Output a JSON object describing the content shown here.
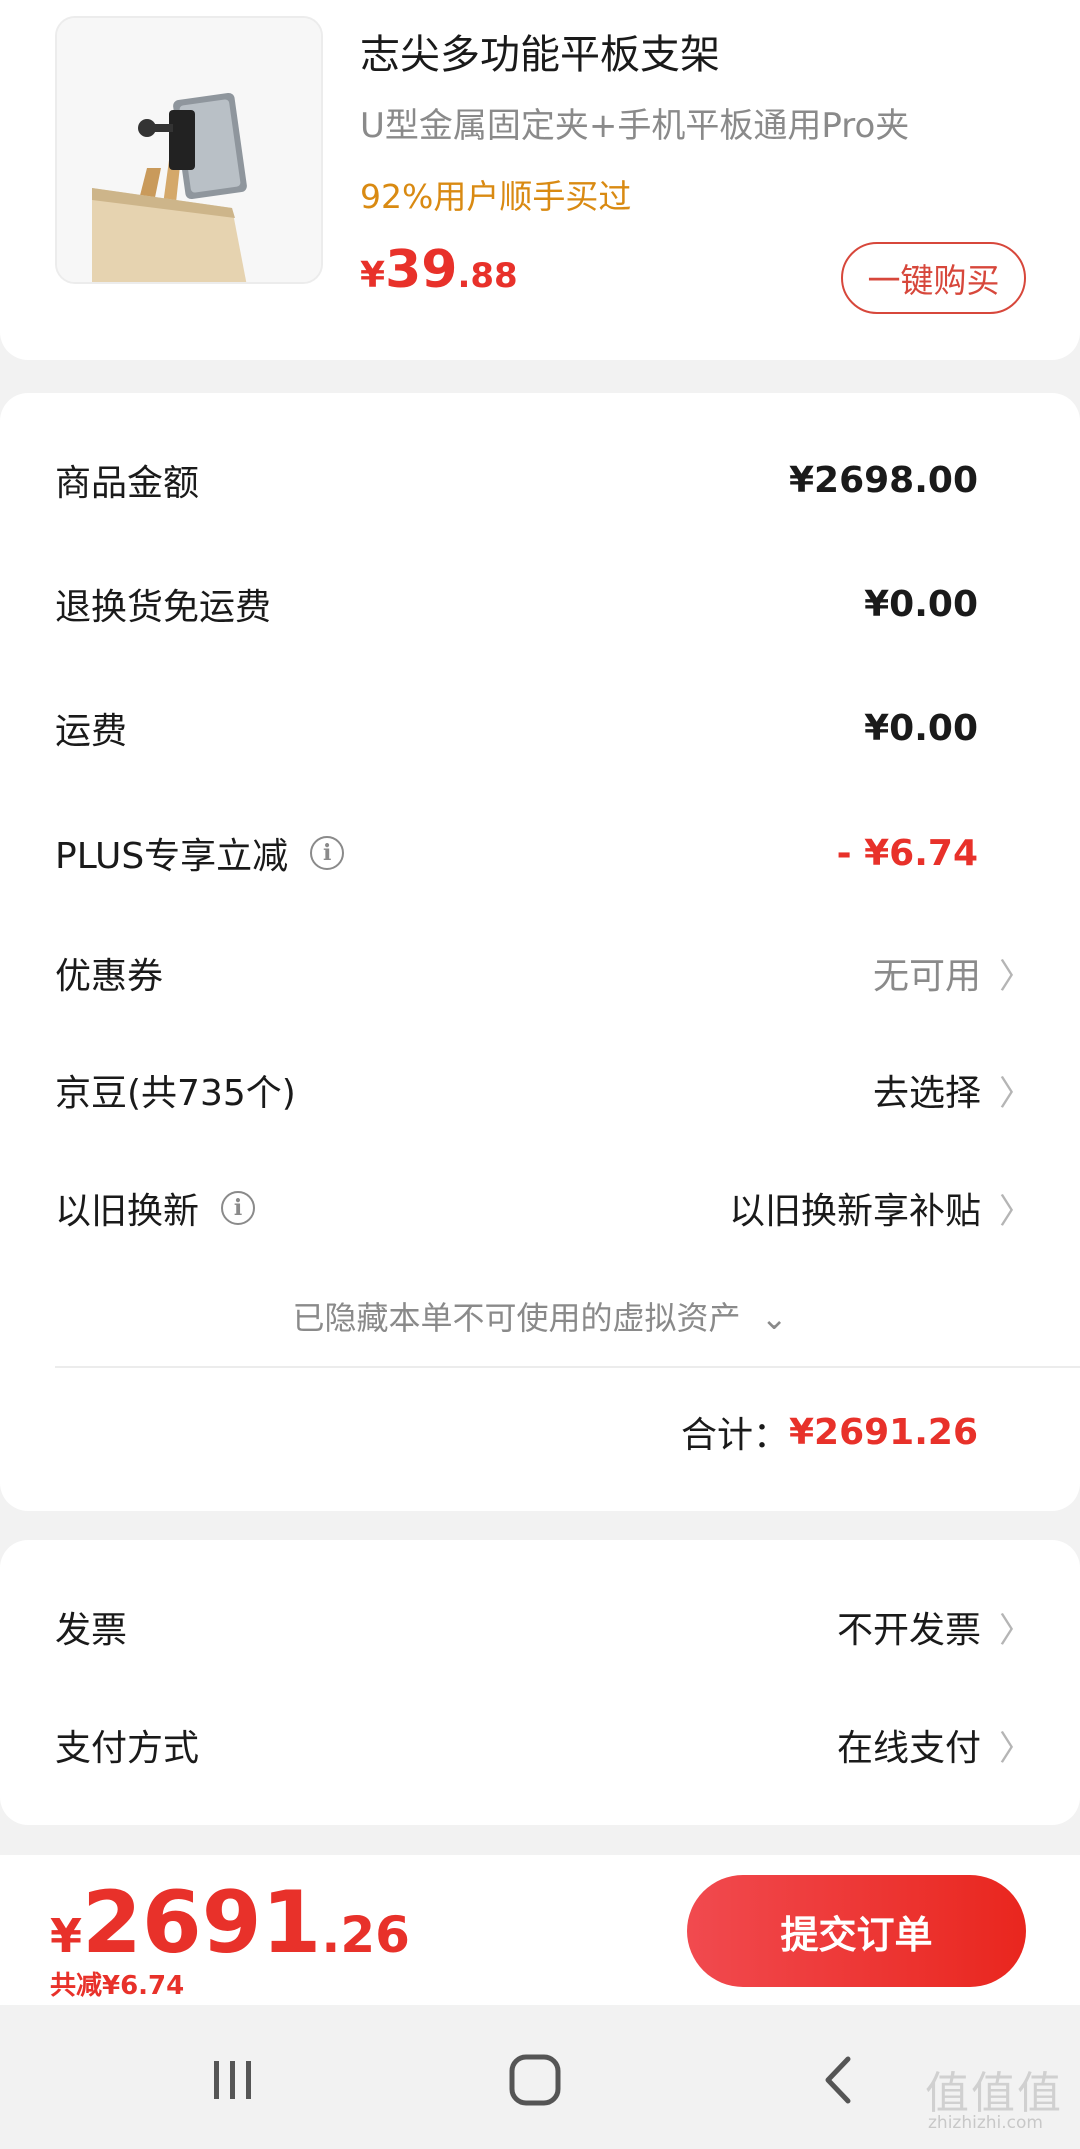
{
  "product": {
    "title": "志尖多功能平板支架",
    "subtitle": "U型金属固定夹+手机平板通用Pro夹",
    "purchase_rate": "92%用户顺手买过",
    "price_currency": "¥",
    "price_int": "39",
    "price_dec": ".88",
    "buy_button": "一键购买"
  },
  "details": {
    "rows": [
      {
        "label": "商品金额",
        "value": "¥2698.00"
      },
      {
        "label": "退换货免运费",
        "value": "¥0.00"
      },
      {
        "label": "运费",
        "value": "¥0.00"
      },
      {
        "label": "PLUS专享立减",
        "value": "- ¥6.74"
      },
      {
        "label": "优惠券",
        "value": "无可用"
      },
      {
        "label": "京豆(共735个)",
        "value": "去选择"
      },
      {
        "label": "以旧换新",
        "value": "以旧换新享补贴"
      }
    ],
    "hidden_note": "已隐藏本单不可使用的虚拟资产",
    "total_label": "合计：",
    "total_value": "¥2691.26"
  },
  "invoice": {
    "rows": [
      {
        "label": "发票",
        "value": "不开发票"
      },
      {
        "label": "支付方式",
        "value": "在线支付"
      }
    ]
  },
  "submit_bar": {
    "currency": "¥",
    "price_int": "2691",
    "price_dec": ".26",
    "discount": "共减¥6.74",
    "submit_button": "提交订单"
  },
  "watermark": {
    "main": "值值值",
    "sub": "zhizhizhi.com"
  },
  "icons": {
    "info": "info-icon",
    "chevron": "chevron-right-icon",
    "expand": "chevron-down-icon",
    "nav": [
      "recent-apps-icon",
      "home-icon",
      "back-icon"
    ]
  },
  "colors": {
    "accent_red": "#e8312a",
    "rate_orange": "#d98a12"
  }
}
